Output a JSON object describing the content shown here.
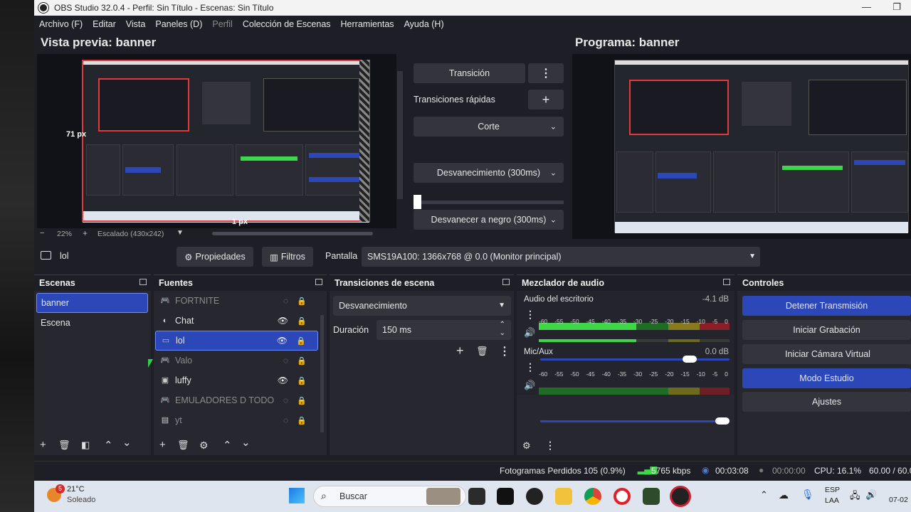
{
  "titlebar": {
    "title": "OBS Studio 32.0.4 - Perfil: Sin Título - Escenas: Sin Título"
  },
  "menu": [
    "Archivo (F)",
    "Editar",
    "Vista",
    "Paneles (D)",
    "Perfil",
    "Colección de Escenas",
    "Herramientas",
    "Ayuda (H)"
  ],
  "preview": {
    "title": "Vista previa: banner",
    "px_left": "71 px",
    "px_bottom": "1 px",
    "zoom": "22%",
    "scale": "Escalado (430x242)"
  },
  "program": {
    "title": "Programa: banner"
  },
  "transitions_panel": {
    "transition": "Transición",
    "quick": "Transiciones rápidas",
    "items": [
      "Corte",
      "Desvanecimiento (300ms)",
      "Desvanecer a negro (300ms)"
    ]
  },
  "source_bar": {
    "name": "lol",
    "properties": "Propiedades",
    "filters": "Filtros",
    "display_label": "Pantalla",
    "display_value": "SMS19A100: 1366x768 @ 0.0 (Monitor principal)"
  },
  "scenes": {
    "title": "Escenas",
    "items": [
      "banner",
      "Escena"
    ]
  },
  "sources": {
    "title": "Fuentes",
    "items": [
      "FORTNITE",
      "Chat",
      "lol",
      "Valo",
      "luffy",
      "EMULADORES D TODO",
      "yt"
    ]
  },
  "scene_transitions": {
    "title": "Transiciones de escena",
    "type": "Desvanecimiento",
    "duration_label": "Duración",
    "duration_value": "150 ms"
  },
  "mixer": {
    "title": "Mezclador de audio",
    "channels": [
      {
        "name": "Audio del escritorio",
        "db": "-4.1 dB",
        "level": 0.96,
        "volume": 0.8
      },
      {
        "name": "Mic/Aux",
        "db": "0.0 dB",
        "level": 0.0,
        "volume": 1.0
      }
    ],
    "scale": [
      "-60",
      "-55",
      "-50",
      "-45",
      "-40",
      "-35",
      "-30",
      "-25",
      "-20",
      "-15",
      "-10",
      "-5",
      "0"
    ]
  },
  "controls": {
    "title": "Controles",
    "buttons": [
      "Detener Transmisión",
      "Iniciar Grabación",
      "Iniciar Cámara Virtual",
      "Modo Estudio",
      "Ajustes"
    ]
  },
  "status": {
    "dropped": "Fotogramas Perdidos 105 (0.9%)",
    "bitrate": "5765 kbps",
    "stream_time": "00:03:08",
    "rec_time": "00:00:00",
    "cpu": "CPU: 16.1%",
    "fps": "60.00 / 60.0"
  },
  "taskbar": {
    "weather_badge": "5",
    "temp": "21°C",
    "condition": "Soleado",
    "search": "Buscar",
    "lang1": "ESP",
    "lang2": "LAA",
    "date": "07-02"
  },
  "colors": {
    "accent": "#2c47b8",
    "bg": "#1e1f26",
    "dock": "#27282f"
  }
}
